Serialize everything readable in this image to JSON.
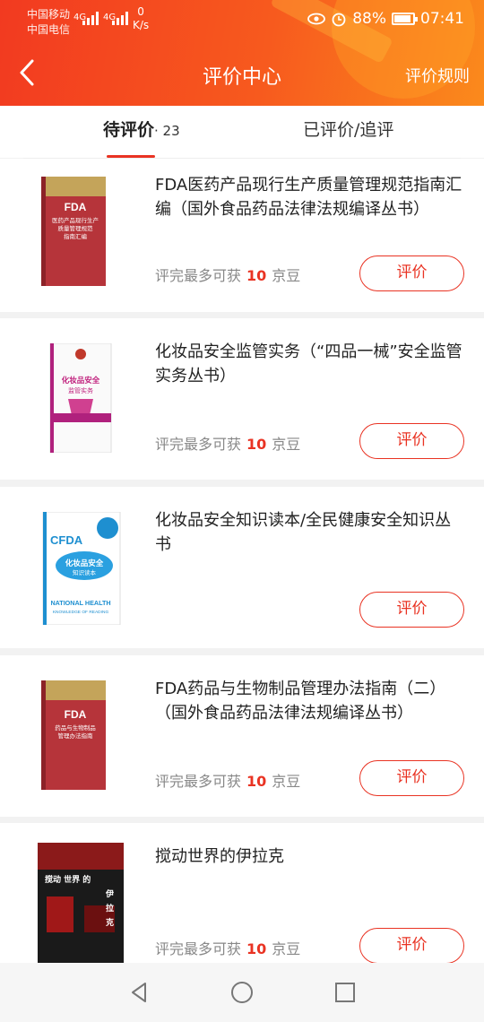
{
  "status_bar": {
    "carrier1": "中国移动",
    "carrier2": "中国电信",
    "net1": "4G",
    "net2": "4G",
    "speed_value": "0",
    "speed_unit": "K/s",
    "battery": "88%",
    "time": "07:41",
    "icons": [
      "eye-icon",
      "alarm-icon",
      "battery-icon"
    ]
  },
  "header": {
    "title": "评价中心",
    "rules_link": "评价规则",
    "back_icon": "chevron-left-icon"
  },
  "tabs": {
    "pending_label": "待评价",
    "pending_count": "· 23",
    "done_label": "已评价/追评"
  },
  "colors": {
    "accent": "#e93323",
    "header_start": "#f23a20",
    "header_end": "#fb8a1c"
  },
  "products": [
    {
      "title": "FDA医药产品现行生产质量管理规范指南汇编（国外食品药品法律法规编译丛书）",
      "reward_prefix": "评完最多可获",
      "reward_num": "10",
      "reward_unit": "京豆",
      "button": "评价",
      "cover_lines": [
        "FDA",
        "医药产品现行生产",
        "质量管理规范",
        "指南汇编"
      ]
    },
    {
      "title": "化妆品安全监管实务（“四品一械”安全监管实务丛书）",
      "reward_prefix": "评完最多可获",
      "reward_num": "10",
      "reward_unit": "京豆",
      "button": "评价",
      "cover_lines": [
        "化妆品安全",
        "监管实务"
      ]
    },
    {
      "title": "化妆品安全知识读本/全民健康安全知识丛书",
      "reward_prefix": "",
      "reward_num": "",
      "reward_unit": "",
      "button": "评价",
      "cover_lines": [
        "CFDA",
        "化妆品安全",
        "知识读本",
        "NATIONAL HEALTH",
        "KNOWLEDGE OF READING"
      ]
    },
    {
      "title": "FDA药品与生物制品管理办法指南（二）（国外食品药品法律法规编译丛书）",
      "reward_prefix": "评完最多可获",
      "reward_num": "10",
      "reward_unit": "京豆",
      "button": "评价",
      "cover_lines": [
        "FDA",
        "药品与生物制品",
        "管理办法指南"
      ]
    },
    {
      "title": "搅动世界的伊拉克",
      "reward_prefix": "评完最多可获",
      "reward_num": "10",
      "reward_unit": "京豆",
      "button": "评价",
      "cover_lines": [
        "搅动 世界 的",
        "伊",
        "拉",
        "克"
      ]
    }
  ],
  "system_nav": [
    "back-triangle-icon",
    "home-circle-icon",
    "recent-square-icon"
  ]
}
